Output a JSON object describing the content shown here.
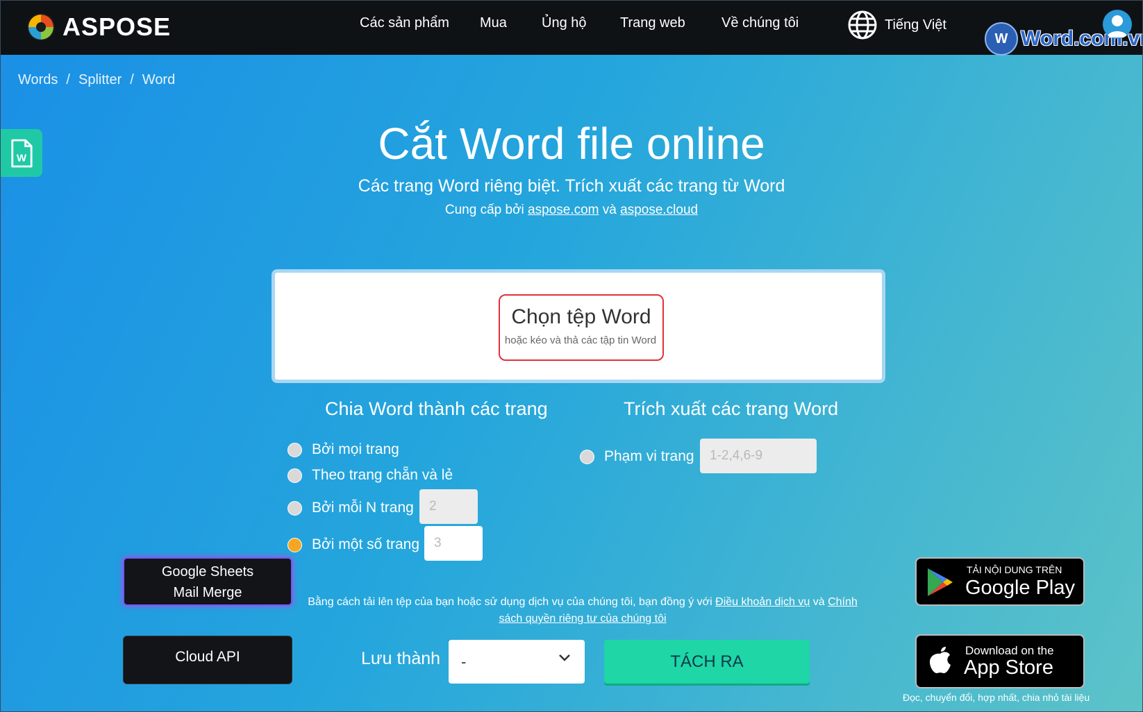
{
  "nav": {
    "brand": "ASPOSE",
    "menu": [
      "Các sản phẩm",
      "Mua",
      "Ủng hộ",
      "Trang web",
      "Về chúng tôi"
    ],
    "language": "Tiếng Việt",
    "watermark": "Word.com.vn"
  },
  "breadcrumb": [
    "Words",
    "Splitter",
    "Word"
  ],
  "hero": {
    "title": "Cắt Word file online",
    "subtitle": "Các trang Word riêng biệt. Trích xuất các trang từ Word",
    "powered_prefix": "Cung cấp bởi",
    "powered_link1": "aspose.com",
    "powered_and": "và",
    "powered_link2": "aspose.cloud"
  },
  "upload": {
    "button": "Chọn tệp Word",
    "hint": "hoặc kéo và thả các tập tin Word"
  },
  "split": {
    "heading": "Chia Word thành các trang",
    "options": [
      "Bởi mọi trang",
      "Theo trang chẵn và lẻ",
      "Bởi mỗi N trang",
      "Bởi một số trang"
    ],
    "selected": "Bởi một số trang",
    "n_value": "2",
    "some_value": "3"
  },
  "extract": {
    "heading": "Trích xuất các trang Word",
    "option": "Phạm vi trang",
    "range_placeholder": "1-2,4,6-9"
  },
  "side": {
    "google_sheets_line1": "Google Sheets",
    "google_sheets_line2": "Mail Merge",
    "cloud_api": "Cloud API"
  },
  "terms": {
    "prefix": "Bằng cách tải lên tệp của bạn hoặc sử dụng dịch vụ của chúng tôi, bạn đồng ý với",
    "link1": "Điều khoản dịch vụ",
    "and": "và",
    "link2": "Chính sách quyền riêng tư của chúng tôi"
  },
  "save": {
    "label": "Lưu thành",
    "value": "-",
    "button": "TÁCH RA"
  },
  "stores": {
    "gp_small": "TẢI NỘI DUNG TRÊN",
    "gp_big": "Google Play",
    "as_small": "Download on the",
    "as_big": "App Store",
    "footnote": "Đọc, chuyển đổi, hợp nhất, chia nhỏ tài liệu"
  },
  "colors": {
    "nav_bg": "#0f1215",
    "accent_green": "#1ed6a6",
    "radio_selected": "#f6a623",
    "upload_outline": "#e0313a"
  }
}
